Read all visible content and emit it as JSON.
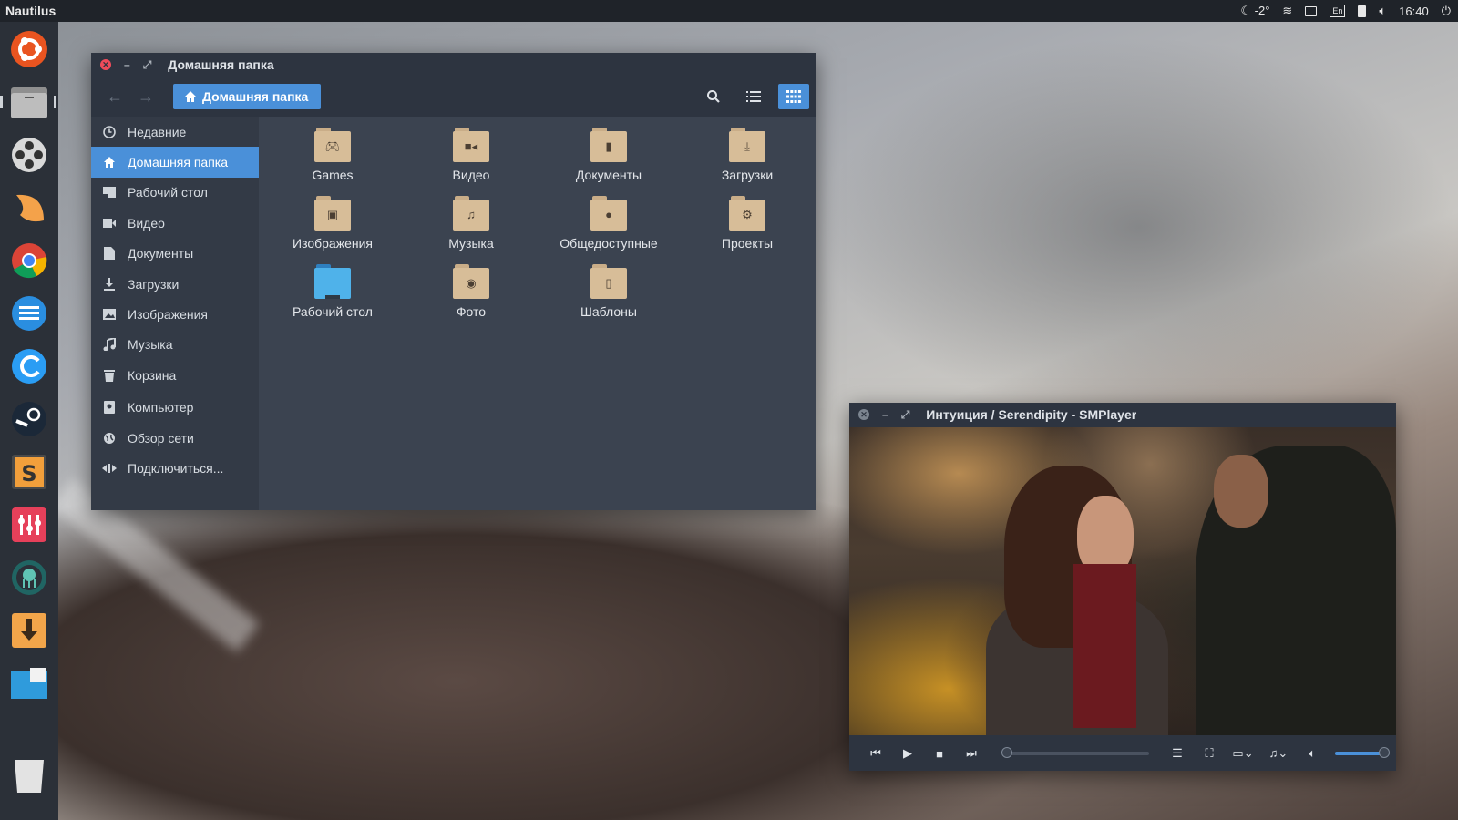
{
  "top_panel": {
    "app_title": "Nautilus",
    "weather": "-2°",
    "keyboard_layout": "En",
    "clock": "16:40"
  },
  "launcher": {
    "items": [
      "ubuntu-icon",
      "files-icon",
      "video-reel-icon",
      "moon-icon",
      "chrome-icon",
      "stream-icon",
      "browser-wave-icon",
      "steam-icon",
      "sublime-icon",
      "mixer-icon",
      "gitkraken-icon",
      "download-icon",
      "workspaces-icon",
      "trash-icon"
    ]
  },
  "nautilus": {
    "title": "Домашняя папка",
    "path_button": "Домашняя папка",
    "sidebar": [
      {
        "label": "Недавние",
        "icon": "clock-icon"
      },
      {
        "label": "Домашняя папка",
        "icon": "home-icon",
        "active": true
      },
      {
        "label": "Рабочий стол",
        "icon": "desktop-icon"
      },
      {
        "label": "Видео",
        "icon": "video-camera-icon"
      },
      {
        "label": "Документы",
        "icon": "document-icon"
      },
      {
        "label": "Загрузки",
        "icon": "download-icon"
      },
      {
        "label": "Изображения",
        "icon": "image-icon"
      },
      {
        "label": "Музыка",
        "icon": "music-note-icon"
      },
      {
        "label": "Корзина",
        "icon": "trash-icon"
      },
      {
        "label": "Компьютер",
        "icon": "drive-icon"
      },
      {
        "label": "Обзор сети",
        "icon": "network-icon"
      },
      {
        "label": "Подключиться...",
        "icon": "connect-icon"
      }
    ],
    "folders": [
      {
        "label": "Games",
        "emblem": "gamepad-icon"
      },
      {
        "label": "Видео",
        "emblem": "video-camera-icon"
      },
      {
        "label": "Документы",
        "emblem": "document-icon"
      },
      {
        "label": "Загрузки",
        "emblem": "download-icon"
      },
      {
        "label": "Изображения",
        "emblem": "image-icon"
      },
      {
        "label": "Музыка",
        "emblem": "music-note-icon"
      },
      {
        "label": "Общедоступные",
        "emblem": "person-icon"
      },
      {
        "label": "Проекты",
        "emblem": "gear-icon"
      },
      {
        "label": "Рабочий стол",
        "emblem": "desktop-icon"
      },
      {
        "label": "Фото",
        "emblem": "camera-icon"
      },
      {
        "label": "Шаблоны",
        "emblem": "template-icon"
      }
    ]
  },
  "smplayer": {
    "title": "Интуиция / Serendipity - SMPlayer",
    "playback_progress": 0.0,
    "volume": 0.9
  },
  "colors": {
    "accent": "#4a90d9",
    "window_bg": "#3b4350",
    "titlebar_bg": "#2d3440",
    "sidebar_bg": "#333a46",
    "folder": "#d7bd98",
    "close_button": "#ee4b5a"
  }
}
